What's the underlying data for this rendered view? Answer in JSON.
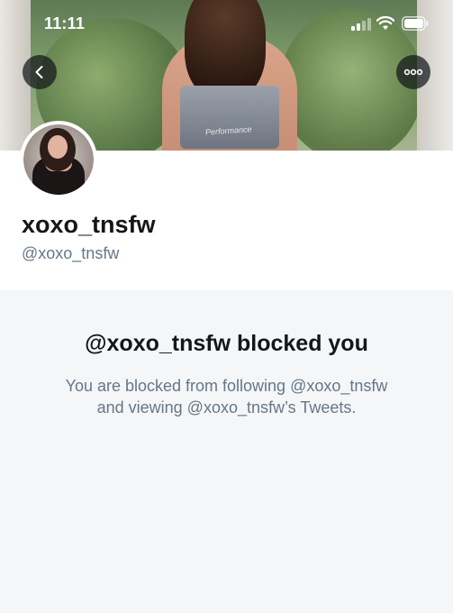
{
  "status_bar": {
    "time": "11:11"
  },
  "header": {
    "back_icon": "chevron-left-icon",
    "more_icon": "more-horizontal-icon",
    "banner_shirt_text": "Performance"
  },
  "profile": {
    "display_name": "xoxo_tnsfw",
    "handle": "@xoxo_tnsfw"
  },
  "blocked": {
    "title": "@xoxo_tnsfw blocked you",
    "line1": "You are blocked from following @xoxo_tnsfw",
    "line2": "and viewing @xoxo_tnsfw’s Tweets."
  },
  "colors": {
    "primary_text": "#14171a",
    "secondary_text": "#657786",
    "blocked_background": "#f5f6f8"
  }
}
